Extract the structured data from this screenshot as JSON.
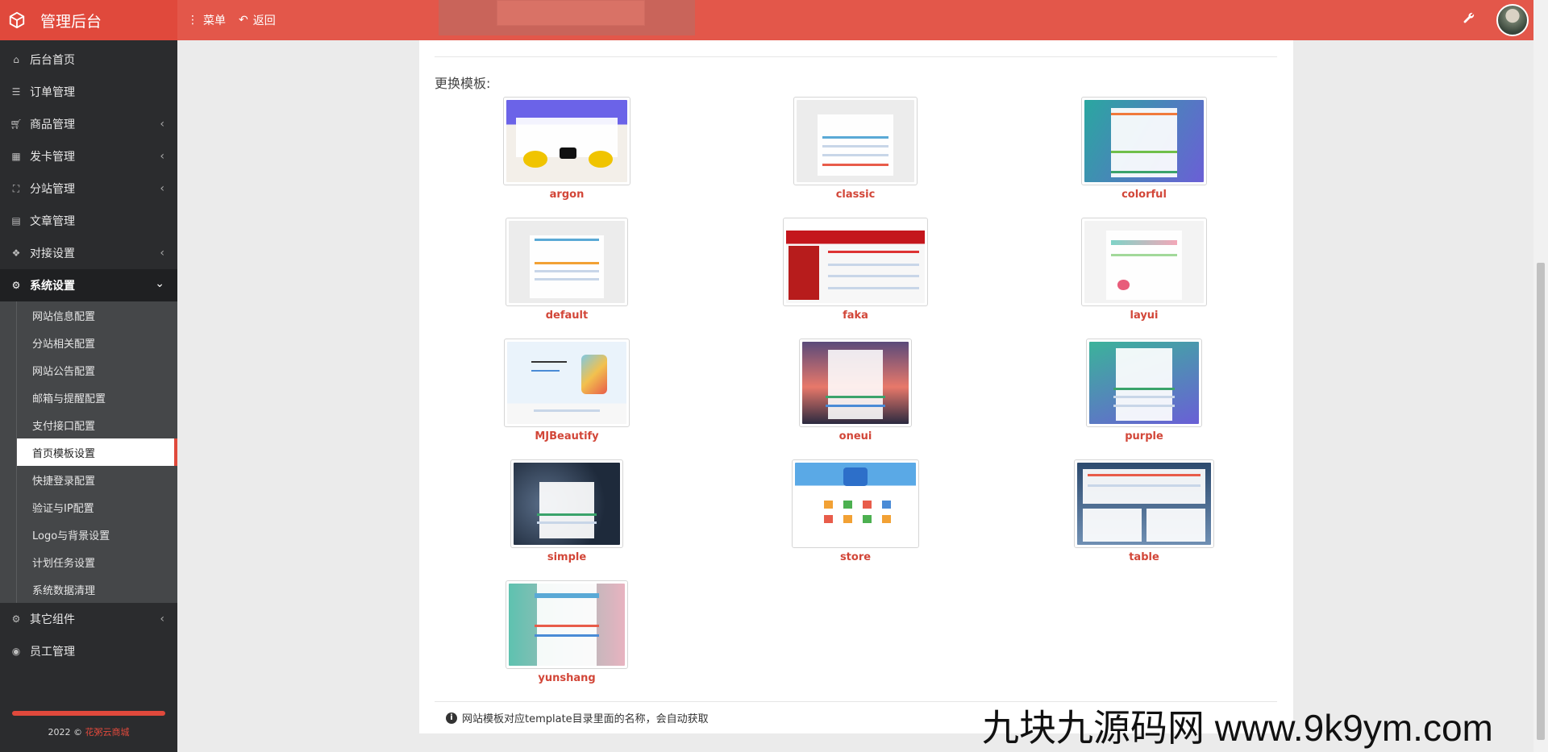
{
  "brand": {
    "title": "管理后台"
  },
  "topnav": {
    "menu_label": "菜单",
    "back_label": "返回"
  },
  "sidebar": {
    "items": [
      {
        "label": "后台首页",
        "icon": "home-icon",
        "has_children": false
      },
      {
        "label": "订单管理",
        "icon": "list-icon",
        "has_children": false
      },
      {
        "label": "商品管理",
        "icon": "cart-icon",
        "has_children": true
      },
      {
        "label": "发卡管理",
        "icon": "grid-icon",
        "has_children": true
      },
      {
        "label": "分站管理",
        "icon": "sitemap-icon",
        "has_children": true
      },
      {
        "label": "文章管理",
        "icon": "book-icon",
        "has_children": false
      },
      {
        "label": "对接设置",
        "icon": "cubes-icon",
        "has_children": true
      },
      {
        "label": "系统设置",
        "icon": "gear-icon",
        "has_children": true,
        "expanded": true
      }
    ],
    "subitems": [
      "网站信息配置",
      "分站相关配置",
      "网站公告配置",
      "邮箱与提醒配置",
      "支付接口配置",
      "首页模板设置",
      "快捷登录配置",
      "验证与IP配置",
      "Logo与背景设置",
      "计划任务设置",
      "系统数据清理"
    ],
    "current_subitem": "首页模板设置",
    "after_items": [
      {
        "label": "其它组件",
        "icon": "cogs-icon",
        "has_children": true
      },
      {
        "label": "员工管理",
        "icon": "user-circle-icon",
        "has_children": false
      }
    ],
    "footer": {
      "prefix": "2022 © ",
      "link": "花粥云商城"
    }
  },
  "main": {
    "section_label": "更换模板:",
    "templates": [
      "argon",
      "classic",
      "colorful",
      "default",
      "faka",
      "layui",
      "MJBeautify",
      "oneui",
      "purple",
      "simple",
      "store",
      "table",
      "yunshang"
    ],
    "notice": "网站模板对应template目录里面的名称，会自动获取"
  },
  "watermark": "九块九源码网 www.9k9ym.com",
  "colors": {
    "accent": "#e3574a",
    "brand_dark": "#e0493c",
    "sidebar_bg": "#2b2c2e",
    "template_name": "#d24638"
  }
}
